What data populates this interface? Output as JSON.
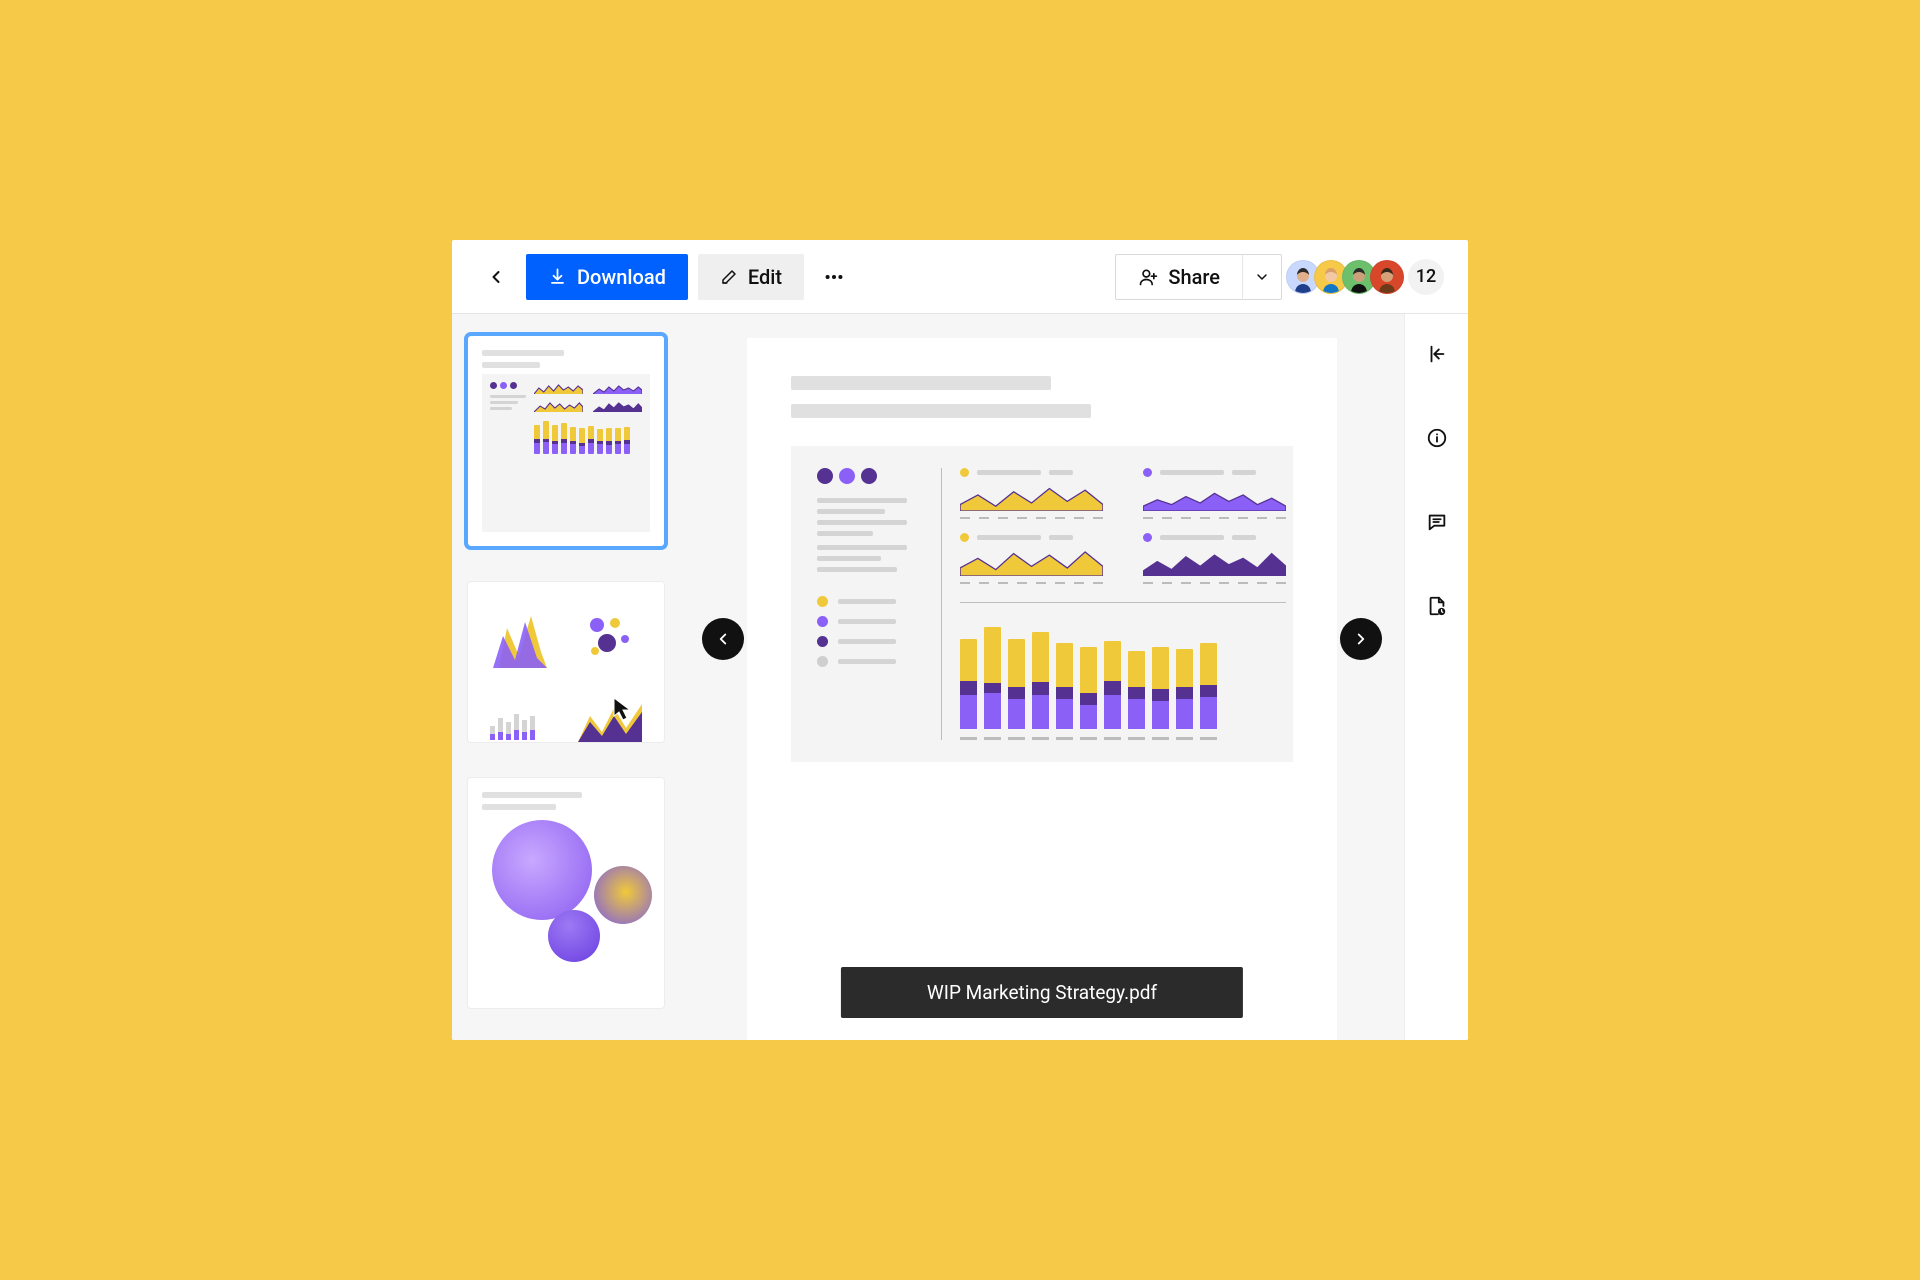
{
  "toolbar": {
    "download_label": "Download",
    "edit_label": "Edit",
    "share_label": "Share",
    "viewer_overflow_count": "12"
  },
  "avatars": [
    {
      "bg": "#c9d8ff",
      "body": "#1f3e8b",
      "head": "#e0b08a",
      "hair": "#2b2b2b"
    },
    {
      "bg": "#f7c948",
      "body": "#1076c5",
      "head": "#f2c9a4",
      "hair": "#d9a06b"
    },
    {
      "bg": "#6cc06c",
      "body": "#111111",
      "head": "#caa07a",
      "hair": "#2b2b2b"
    },
    {
      "bg": "#d9472b",
      "body": "#6d3a1a",
      "head": "#d6a27a",
      "hair": "#3a2a1a"
    }
  ],
  "filename": "WIP Marketing Strategy.pdf",
  "colors": {
    "accent_yellow": "#f0c93b",
    "accent_violet": "#8b60f6",
    "accent_deep_purple": "#553192",
    "brand_blue": "#0061fe"
  },
  "thumbnails": {
    "selected_index": 0,
    "count": 3
  },
  "chart_data": {
    "legend_colors": [
      "#f0c93b",
      "#8b60f6",
      "#553192",
      "#cfcfcf"
    ],
    "header_dots": [
      "#553192",
      "#8b60f6",
      "#553192"
    ],
    "sparklines": [
      {
        "dot": "#f0c93b",
        "stroke": "#553192",
        "fill": "#f0c93b",
        "points": [
          4,
          10,
          3,
          12,
          5,
          14,
          6,
          13,
          4
        ]
      },
      {
        "dot": "#8b60f6",
        "stroke": "#553192",
        "fill": "#8b60f6",
        "points": [
          3,
          7,
          4,
          9,
          5,
          11,
          6,
          10,
          4,
          8,
          3
        ]
      },
      {
        "dot": "#f0c93b",
        "stroke": "#553192",
        "fill": "#f0c93b",
        "points": [
          5,
          11,
          4,
          14,
          6,
          13,
          5,
          15,
          6
        ]
      },
      {
        "dot": "#8b60f6",
        "stroke": "#553192",
        "fill": "#553192",
        "points": [
          3,
          9,
          4,
          12,
          6,
          13,
          7,
          11,
          5,
          14,
          6
        ]
      }
    ],
    "stacked_bars": {
      "type": "bar",
      "segments": [
        "yellow",
        "deep_purple",
        "violet"
      ],
      "bars": [
        {
          "yellow": 42,
          "deep_purple": 14,
          "violet": 34
        },
        {
          "yellow": 56,
          "deep_purple": 10,
          "violet": 36
        },
        {
          "yellow": 48,
          "deep_purple": 12,
          "violet": 30
        },
        {
          "yellow": 50,
          "deep_purple": 13,
          "violet": 34
        },
        {
          "yellow": 44,
          "deep_purple": 12,
          "violet": 30
        },
        {
          "yellow": 46,
          "deep_purple": 12,
          "violet": 24
        },
        {
          "yellow": 40,
          "deep_purple": 14,
          "violet": 34
        },
        {
          "yellow": 36,
          "deep_purple": 12,
          "violet": 30
        },
        {
          "yellow": 42,
          "deep_purple": 12,
          "violet": 28
        },
        {
          "yellow": 38,
          "deep_purple": 12,
          "violet": 30
        },
        {
          "yellow": 42,
          "deep_purple": 12,
          "violet": 32
        }
      ]
    }
  }
}
